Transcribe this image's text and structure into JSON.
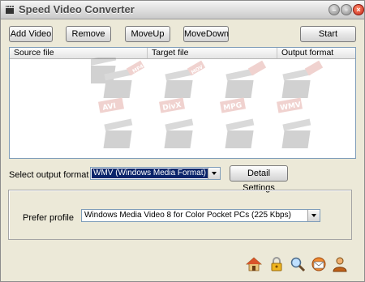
{
  "window": {
    "title": "Speed Video Converter"
  },
  "toolbar": {
    "add_video": "Add Video",
    "remove": "Remove",
    "move_up": "MoveUp",
    "move_down": "MoveDown",
    "start": "Start"
  },
  "file_list": {
    "columns": [
      "Source file",
      "Target file",
      "Output format"
    ],
    "rows": [],
    "watermark_formats": [
      "MP4",
      "MOV",
      "AVI",
      "DivX",
      "MPG",
      "WMV"
    ]
  },
  "output": {
    "label": "Select output format",
    "selected": "WMV (Windows Media Format)",
    "details_button": "Detail Settings"
  },
  "profile": {
    "label": "Prefer profile",
    "selected": "Windows Media Video 8 for Color Pocket PCs (225 Kbps)"
  },
  "bottom_icons": [
    "home-icon",
    "lock-icon",
    "search-icon",
    "mail-icon",
    "user-icon"
  ],
  "colors": {
    "selected_format_bg": "#0a246a",
    "close_button": "#c8281a"
  }
}
